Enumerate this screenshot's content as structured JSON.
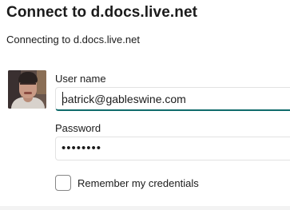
{
  "dialog": {
    "title": "Connect to d.docs.live.net",
    "subtitle": "Connecting to d.docs.live.net"
  },
  "form": {
    "username_label": "User name",
    "username_value": "patrick@gableswine.com",
    "password_label": "Password",
    "password_value": "••••••••",
    "remember_label": "Remember my credentials",
    "remember_checked": false
  },
  "colors": {
    "focus_underline": "#0f6b6b",
    "field_border": "#e2e2e2"
  }
}
